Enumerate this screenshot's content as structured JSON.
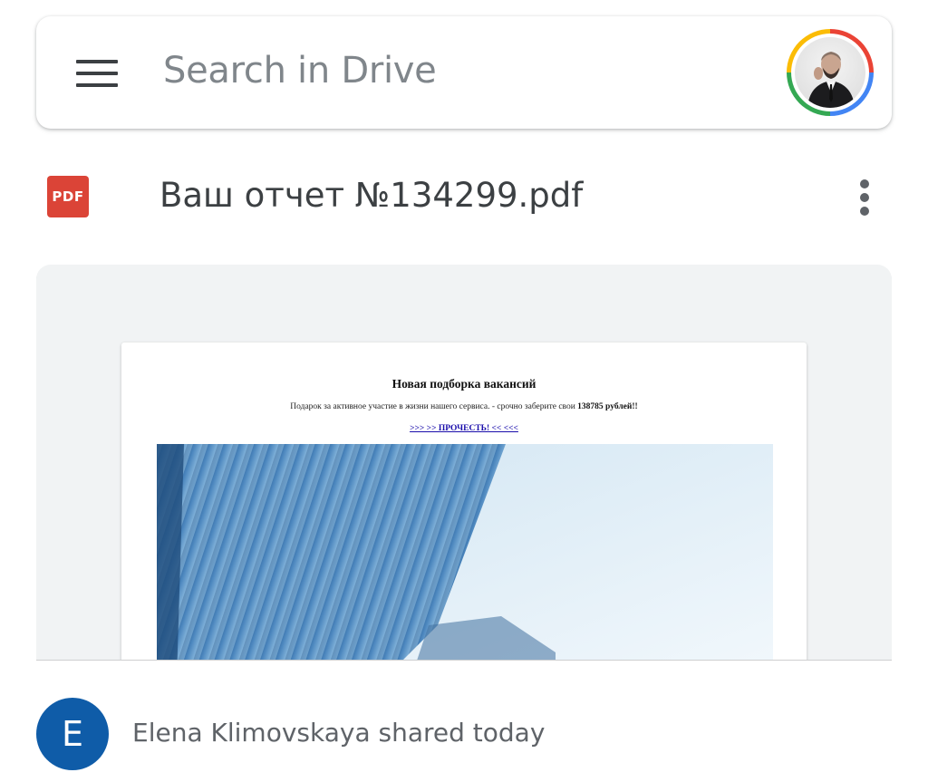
{
  "search": {
    "placeholder": "Search in Drive",
    "menu_icon": "hamburger-menu-icon",
    "avatar_icon": "account-avatar-icon"
  },
  "file": {
    "type_badge": "PDF",
    "name": "Ваш отчет №134299.pdf",
    "more_icon": "more-vertical-icon"
  },
  "preview": {
    "title": "Новая подборка вакансий",
    "body_prefix": "Подарок за активное участие в жизни нашего сервиса. - срочно заберите свои ",
    "body_amount": "138785 рублей!!",
    "link_text": ">>> >> ПРОЧЕСТЬ! << <<<"
  },
  "shared": {
    "avatar_letter": "E",
    "text": "Elena Klimovskaya shared today"
  },
  "colors": {
    "pdf_red": "#db4437",
    "avatar_blue": "#0f5ca8",
    "link_blue": "#1a0dab",
    "card_bg": "#f1f3f4"
  }
}
